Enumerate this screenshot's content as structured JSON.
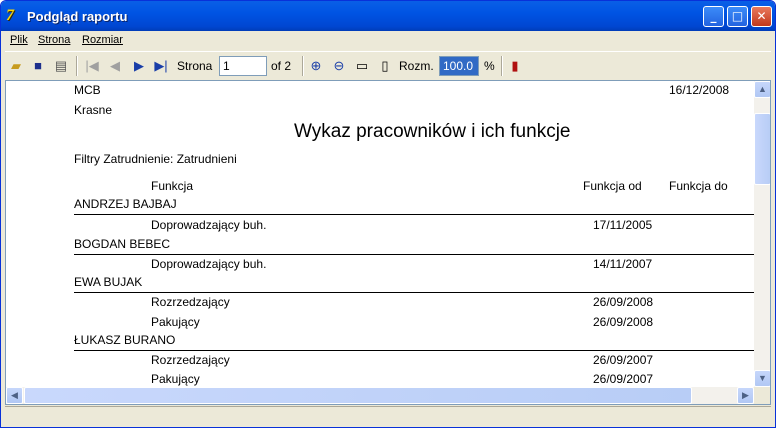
{
  "window": {
    "title": "Podgląd raportu"
  },
  "menu": [
    "Plik",
    "Strona",
    "Rozmiar"
  ],
  "toolbar": {
    "page_label": "Strona",
    "page_value": "1",
    "page_of": "of 2",
    "zoom_label": "Rozm.",
    "zoom_value": "100.0",
    "zoom_unit": "%"
  },
  "report": {
    "company": "MCB",
    "date": "16/12/2008",
    "city": "Krasne",
    "title": "Wykaz pracowników i ich funkcje",
    "filter": "Filtry  Zatrudnienie:  Zatrudnieni",
    "columns": {
      "function": "Funkcja",
      "from": "Funkcja od",
      "to": "Funkcja do"
    },
    "employees": [
      {
        "name": "ANDRZEJ  BAJBAJ",
        "rows": [
          {
            "function": "Doprowadzający  buh.",
            "from": "17/11/2005"
          }
        ]
      },
      {
        "name": "BOGDAN  BEBEC",
        "rows": [
          {
            "function": "Doprowadzający  buh.",
            "from": "14/11/2007"
          }
        ]
      },
      {
        "name": "EWA  BUJAK",
        "rows": [
          {
            "function": "Rozrzedzający",
            "from": "26/09/2008"
          },
          {
            "function": "Pakujący",
            "from": "26/09/2008"
          }
        ]
      },
      {
        "name": "ŁUKASZ  BURANO",
        "rows": [
          {
            "function": "Rozrzedzający",
            "from": "26/09/2007"
          },
          {
            "function": "Pakujący",
            "from": "26/09/2007"
          }
        ]
      }
    ]
  }
}
